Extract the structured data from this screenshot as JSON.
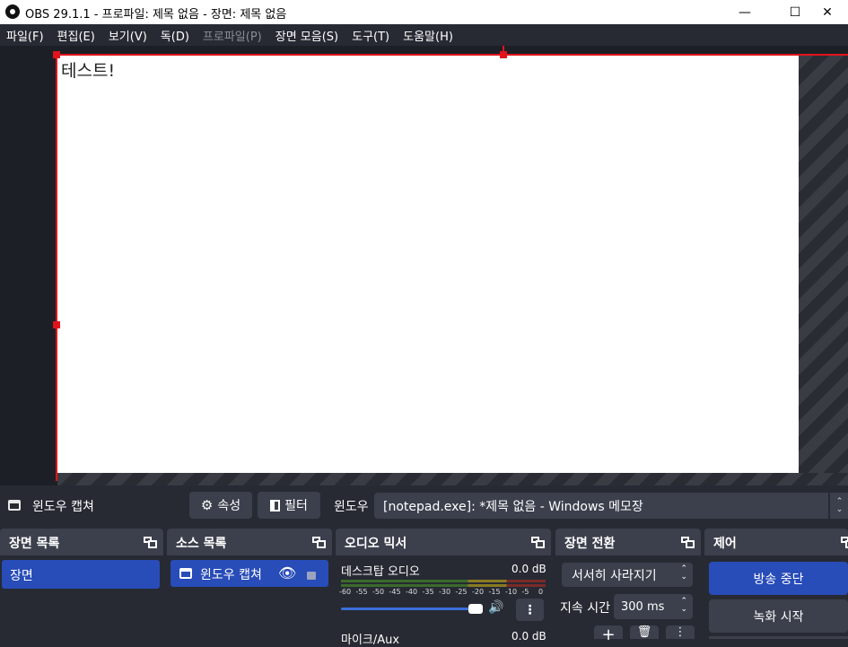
{
  "window": {
    "title": "OBS 29.1.1 - 프로파일: 제목 없음 - 장면: 제목 없음",
    "minimize": "—",
    "maximize": "☐",
    "close": "✕"
  },
  "menu": [
    {
      "label": "파일(F)",
      "disabled": false
    },
    {
      "label": "편집(E)",
      "disabled": false
    },
    {
      "label": "보기(V)",
      "disabled": false
    },
    {
      "label": "독(D)",
      "disabled": false
    },
    {
      "label": "프로파일(P)",
      "disabled": true
    },
    {
      "label": "장면 모음(S)",
      "disabled": false
    },
    {
      "label": "도구(T)",
      "disabled": false
    },
    {
      "label": "도움말(H)",
      "disabled": false
    }
  ],
  "preview": {
    "canvas_text": "테스트!"
  },
  "source_toolbar": {
    "source_name": "윈도우 캡쳐",
    "properties_label": "속성",
    "filters_label": "필터",
    "window_label": "윈도우",
    "window_value": "[notepad.exe]: *제목 없음 - Windows 메모장"
  },
  "scenes": {
    "title": "장면 목록",
    "items": [
      "장면"
    ]
  },
  "sources": {
    "title": "소스 목록",
    "items": [
      "윈도우 캡쳐"
    ]
  },
  "mixer": {
    "title": "오디오 믹서",
    "channels": [
      {
        "name": "데스크탑 오디오",
        "level": "0.0 dB"
      },
      {
        "name": "마이크/Aux",
        "level": "0.0 dB"
      }
    ],
    "ticks": [
      "-60",
      "-55",
      "-50",
      "-45",
      "-40",
      "-35",
      "-30",
      "-25",
      "-20",
      "-15",
      "-10",
      "-5",
      "0"
    ]
  },
  "transitions": {
    "title": "장면 전환",
    "selected": "서서히 사라지기",
    "duration_label": "지속 시간",
    "duration_value": "300 ms"
  },
  "controls": {
    "title": "제어",
    "stream_button": "방송 중단",
    "record_button": "녹화 시작"
  },
  "colors": {
    "accent": "#284cb8",
    "selection_red": "#e0141c",
    "panel": "#3c404d",
    "background": "#272a33"
  }
}
